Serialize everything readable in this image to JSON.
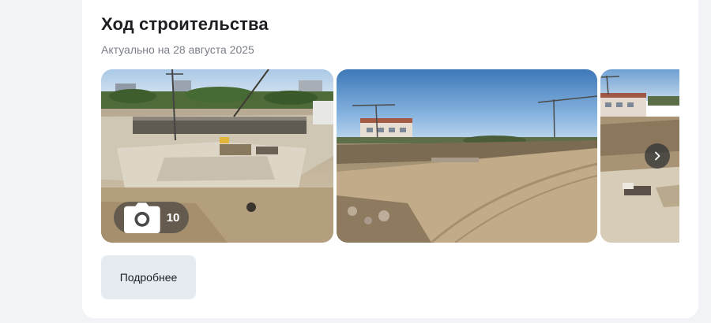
{
  "section": {
    "title": "Ход строительства",
    "subtitle": "Актуально на 28 августа 2025"
  },
  "gallery": {
    "photo_count": "10",
    "photos": [
      {
        "label": "construction-photo-1"
      },
      {
        "label": "construction-photo-2"
      },
      {
        "label": "construction-photo-3"
      }
    ],
    "icons": {
      "count": "camera-icon",
      "next": "chevron-right-icon"
    }
  },
  "actions": {
    "more_label": "Подробнее"
  }
}
